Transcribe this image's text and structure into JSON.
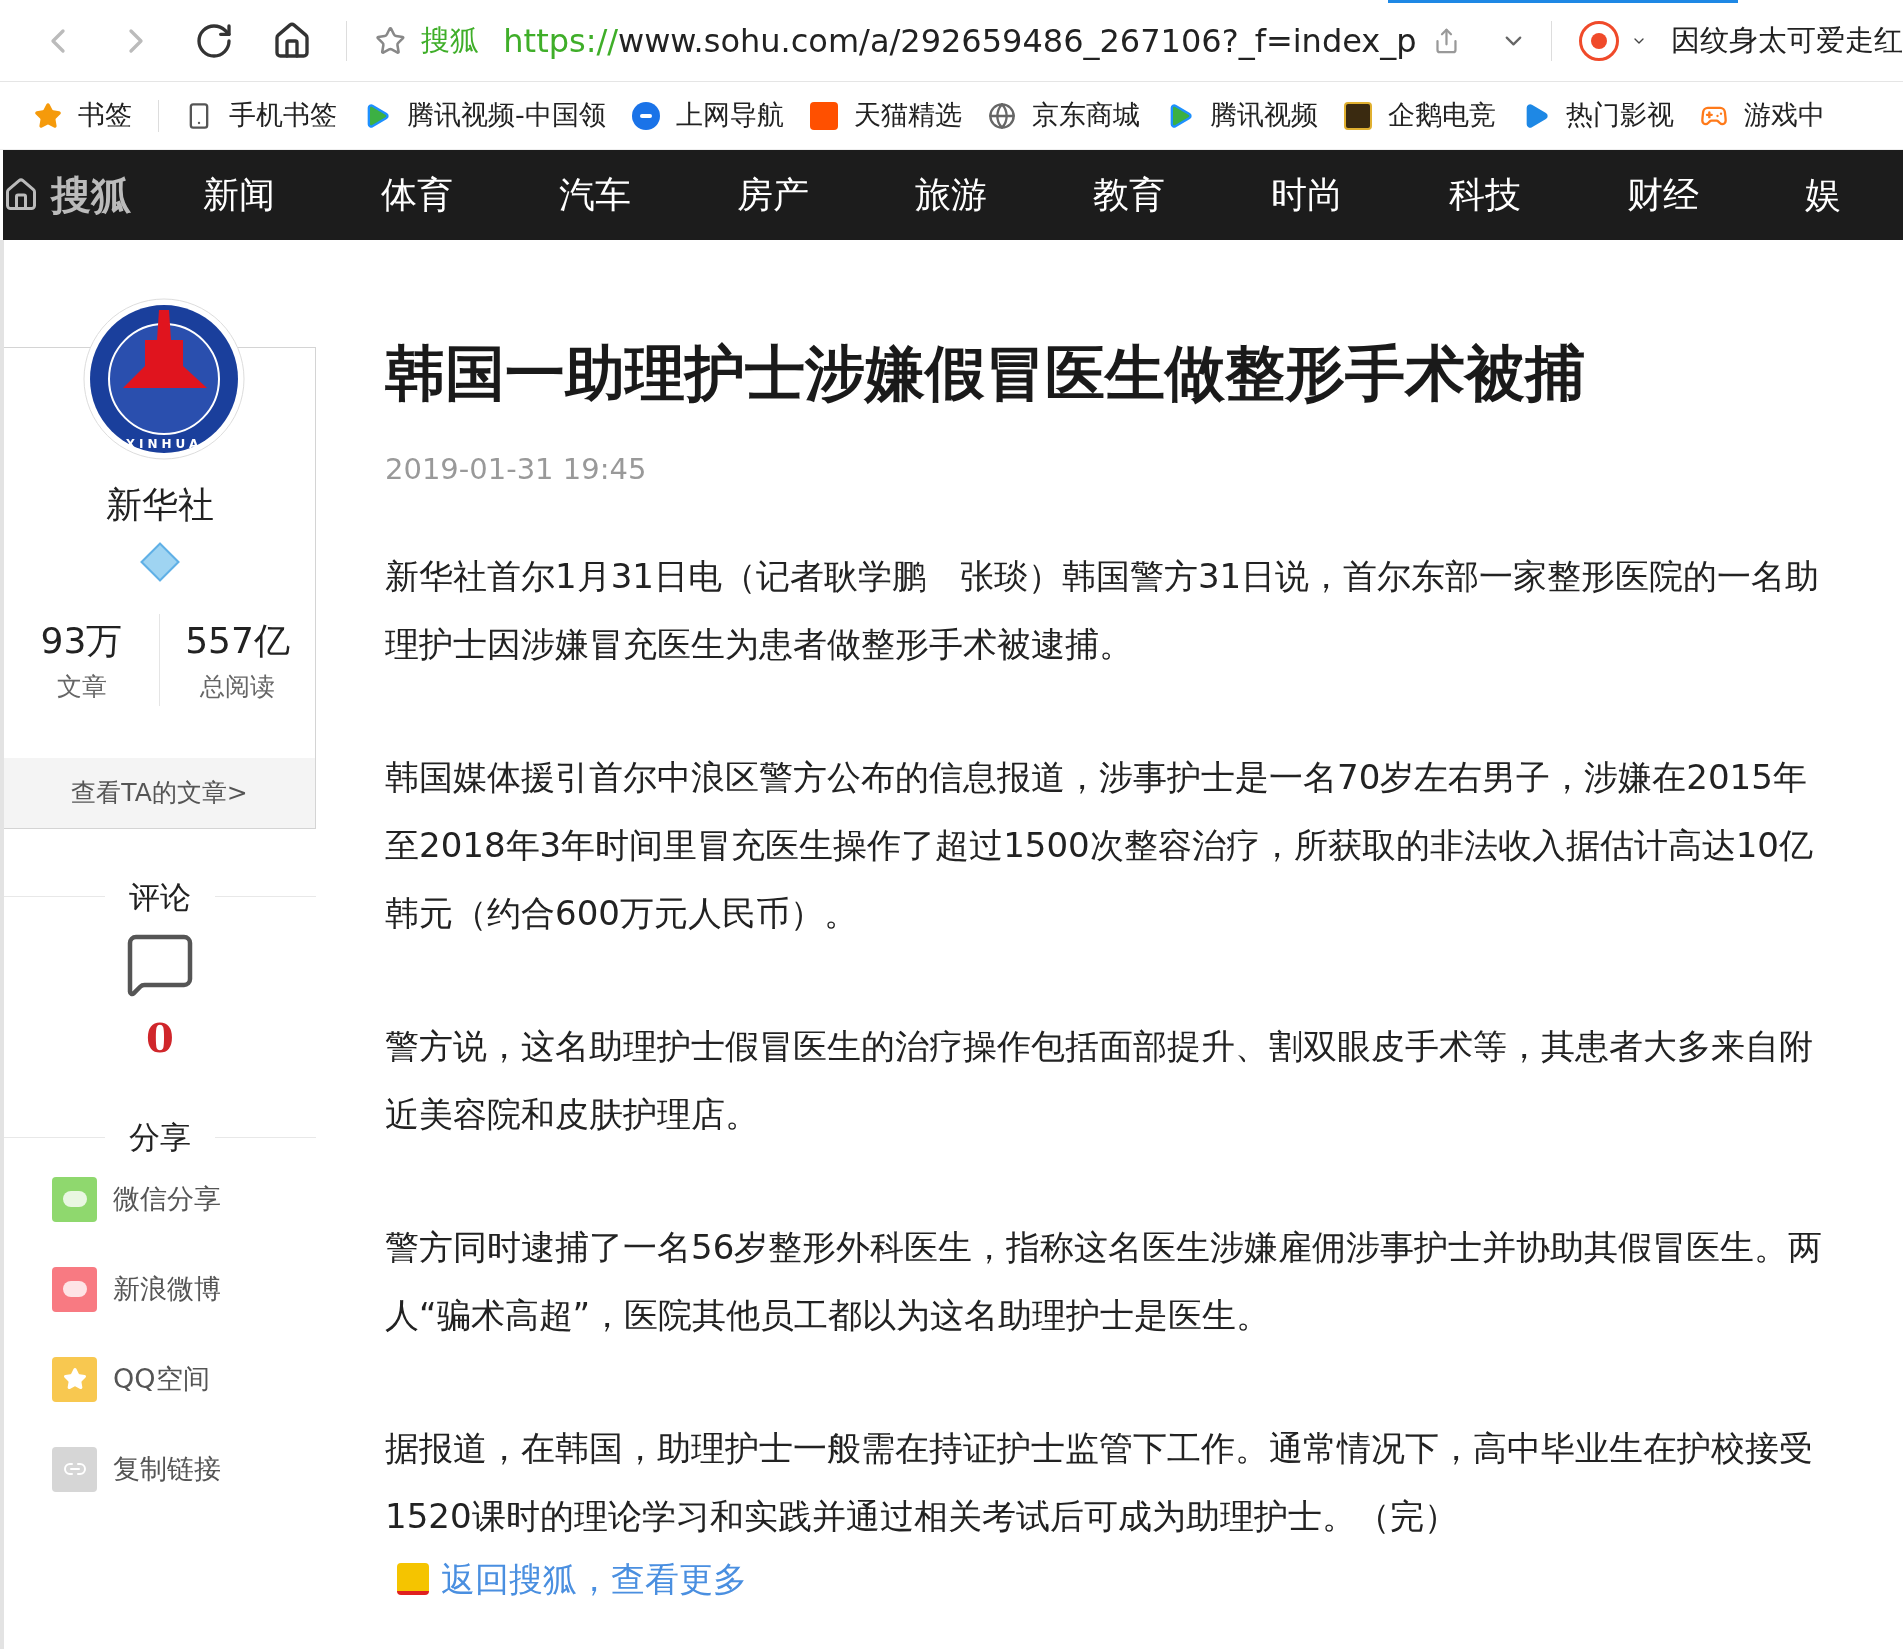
{
  "browser": {
    "site_label": "搜狐",
    "url_scheme": "https://",
    "url_rest": "www.sohu.com/a/292659486_267106?_f=index_p",
    "search_text": "因纹身太可爱走红"
  },
  "bookmarks": [
    "书签",
    "手机书签",
    "腾讯视频-中国领",
    "上网导航",
    "天猫精选",
    "京东商城",
    "腾讯视频",
    "企鹅电竞",
    "热门影视",
    "游戏中"
  ],
  "nav": {
    "brand": "搜狐",
    "items": [
      "新闻",
      "体育",
      "汽车",
      "房产",
      "旅游",
      "教育",
      "时尚",
      "科技",
      "财经",
      "娱"
    ]
  },
  "author": {
    "logo_text": "XINHUA",
    "name": "新华社",
    "stats": [
      {
        "value": "93万",
        "label": "文章"
      },
      {
        "value": "557亿",
        "label": "总阅读"
      }
    ],
    "link": "查看TA的文章>"
  },
  "comments": {
    "heading": "评论",
    "count": "0"
  },
  "share": {
    "heading": "分享",
    "items": [
      {
        "label": "微信分享",
        "color": "#8fd86e"
      },
      {
        "label": "新浪微博",
        "color": "#f87a82"
      },
      {
        "label": "QQ空间",
        "color": "#f8c850"
      },
      {
        "label": "复制链接",
        "color": "#d6d6d6"
      }
    ]
  },
  "article": {
    "title": "韩国一助理护士涉嫌假冒医生做整形手术被捕",
    "date": "2019-01-31 19:45",
    "paragraphs": [
      "新华社首尔1月31日电（记者耿学鹏　张琰）韩国警方31日说，首尔东部一家整形医院的一名助理护士因涉嫌冒充医生为患者做整形手术被逮捕。",
      "韩国媒体援引首尔中浪区警方公布的信息报道，涉事护士是一名70岁左右男子，涉嫌在2015年至2018年3年时间里冒充医生操作了超过1500次整容治疗，所获取的非法收入据估计高达10亿韩元（约合600万元人民币）。",
      "警方说，这名助理护士假冒医生的治疗操作包括面部提升、割双眼皮手术等，其患者大多来自附近美容院和皮肤护理店。",
      "警方同时逮捕了一名56岁整形外科医生，指称这名医生涉嫌雇佣涉事护士并协助其假冒医生。两人“骗术高超”，医院其他员工都以为这名助理护士是医生。",
      "据报道，在韩国，助理护士一般需在持证护士监管下工作。通常情况下，高中毕业生在护校接受1520课时的理论学习和实践并通过相关考试后可成为助理护士。（完）"
    ],
    "back_link": "返回搜狐，查看更多"
  }
}
